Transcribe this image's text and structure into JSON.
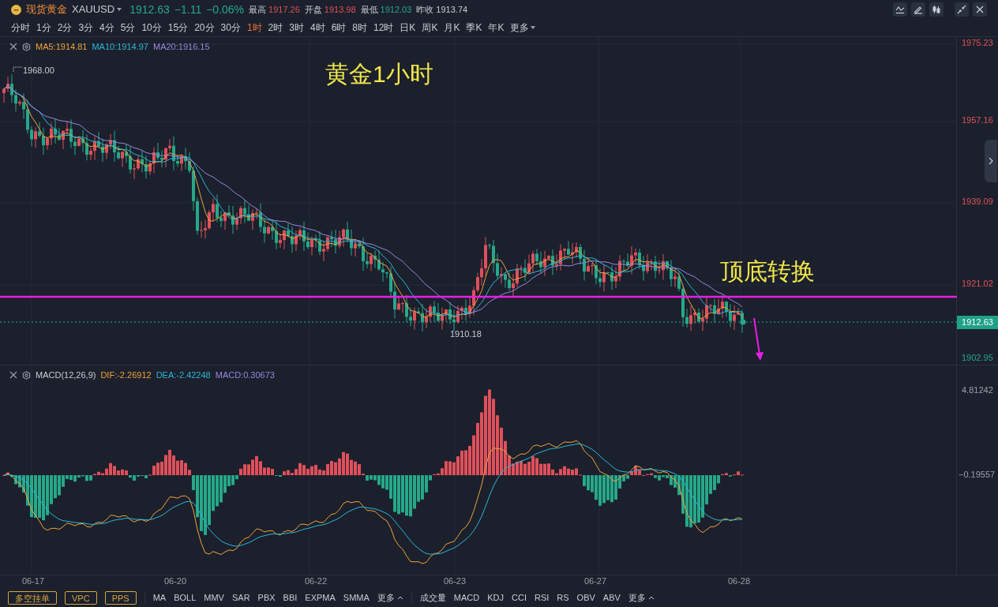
{
  "header": {
    "name": "现货黄金",
    "symbol": "XAUUSD",
    "price": "1912.63",
    "change": "−1.11",
    "percent": "−0.06%",
    "color": "#26a889",
    "stats": [
      {
        "label": "最高",
        "value": "1917.26",
        "color": "#e0505a"
      },
      {
        "label": "开盘",
        "value": "1913.98",
        "color": "#e0505a"
      },
      {
        "label": "最低",
        "value": "1912.03",
        "color": "#26a889"
      },
      {
        "label": "昨收",
        "value": "1913.74",
        "color": "#c8ccd4"
      }
    ]
  },
  "timeframes": [
    {
      "label": "分时",
      "selected": false
    },
    {
      "label": "1分",
      "selected": false
    },
    {
      "label": "2分",
      "selected": false
    },
    {
      "label": "3分",
      "selected": false
    },
    {
      "label": "4分",
      "selected": false
    },
    {
      "label": "5分",
      "selected": false
    },
    {
      "label": "10分",
      "selected": false
    },
    {
      "label": "15分",
      "selected": false
    },
    {
      "label": "20分",
      "selected": false
    },
    {
      "label": "30分",
      "selected": false
    },
    {
      "label": "1时",
      "selected": true
    },
    {
      "label": "2时",
      "selected": false
    },
    {
      "label": "3时",
      "selected": false
    },
    {
      "label": "4时",
      "selected": false
    },
    {
      "label": "6时",
      "selected": false
    },
    {
      "label": "8时",
      "selected": false
    },
    {
      "label": "12时",
      "selected": false
    },
    {
      "label": "日K",
      "selected": false
    },
    {
      "label": "周K",
      "selected": false
    },
    {
      "label": "月K",
      "selected": false
    },
    {
      "label": "季K",
      "selected": false
    },
    {
      "label": "年K",
      "selected": false
    }
  ],
  "more_timeframes": "更多",
  "price_pane": {
    "legend": [
      {
        "label": "MA5:1914.81",
        "color": "#f0a33c"
      },
      {
        "label": "MA10:1914.97",
        "color": "#2bb7d6"
      },
      {
        "label": "MA20:1916.15",
        "color": "#9a86e0"
      }
    ],
    "axis": [
      "1975.23",
      "1957.16",
      "1939.09",
      "1921.02",
      "1902.95"
    ],
    "current_price": "1912.63",
    "high_label": "1968.00",
    "low_label": "1910.18",
    "annotations": [
      "黄金1小时",
      "顶底转换"
    ]
  },
  "macd_pane": {
    "title": "MACD(12,26,9)",
    "legend": [
      {
        "label": "DIF:-2.26912",
        "color": "#f0a33c"
      },
      {
        "label": "DEA:-2.42248",
        "color": "#2bb7d6"
      },
      {
        "label": "MACD:0.30673",
        "color": "#9a86e0"
      }
    ],
    "axis": [
      "4.81242",
      "−0.19557"
    ]
  },
  "dates": [
    "06-17",
    "06-20",
    "06-22",
    "06-23",
    "06-27",
    "06-28"
  ],
  "order_buttons": [
    "多空挂单",
    "VPC",
    "PPS"
  ],
  "main_indicators": [
    "MA",
    "BOLL",
    "MMV",
    "SAR",
    "PBX",
    "BBI",
    "EXPMA",
    "SMMA",
    "更多"
  ],
  "sub_indicators": [
    "成交量",
    "MACD",
    "KDJ",
    "CCI",
    "RSI",
    "RS",
    "OBV",
    "ABV",
    "更多"
  ]
}
